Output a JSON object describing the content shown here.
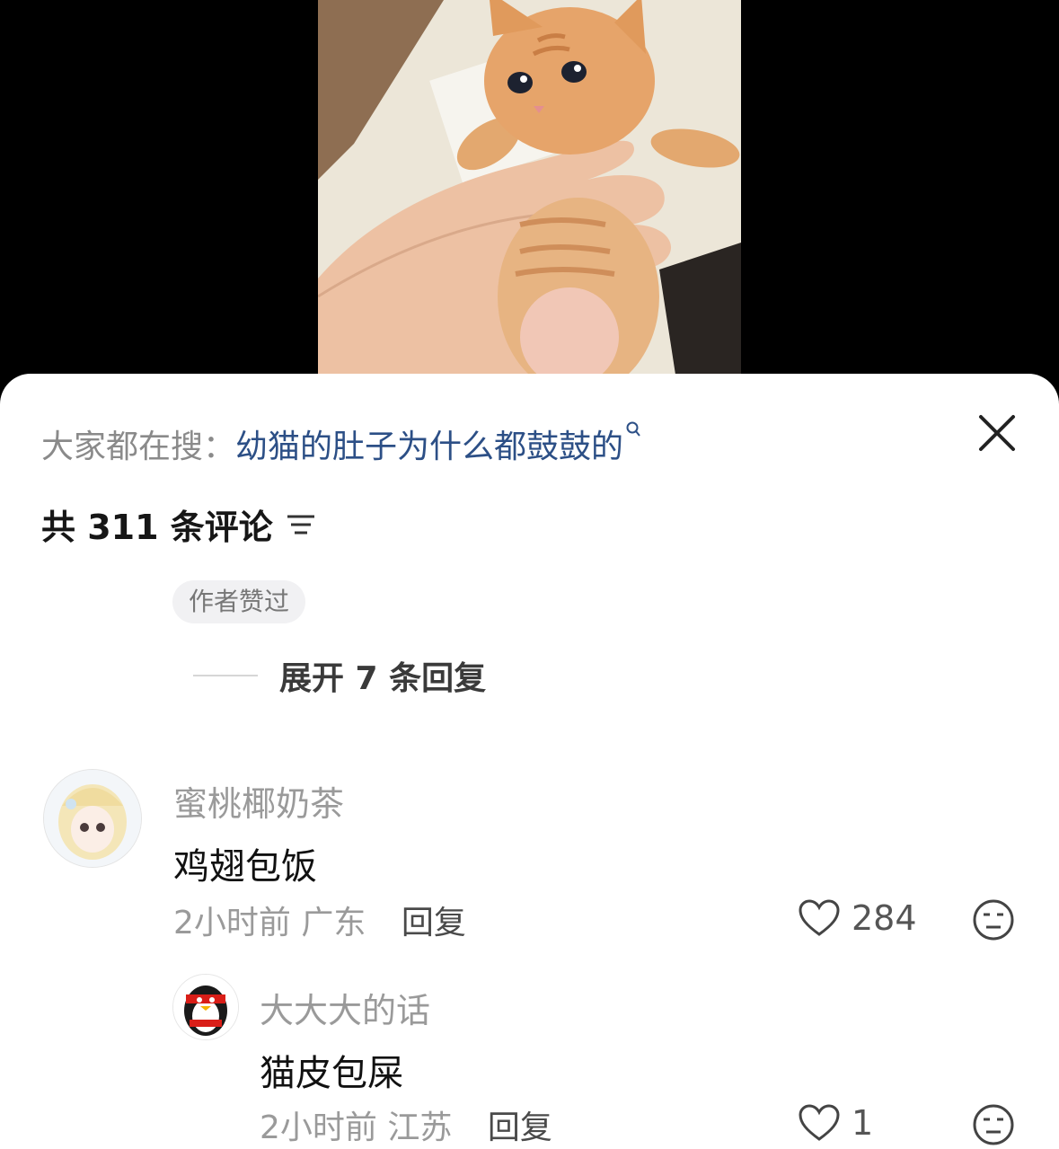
{
  "search_bar": {
    "label": "大家都在搜：",
    "query": "幼猫的肚子为什么都鼓鼓的"
  },
  "comments_header": {
    "count_label": "共 311 条评论"
  },
  "author_liked_badge": "作者赞过",
  "expand_replies": "展开 7 条回复",
  "comments": [
    {
      "username": "蜜桃椰奶茶",
      "text": "鸡翅包饭",
      "time": "2小时前",
      "location": "广东",
      "reply_label": "回复",
      "likes": "284"
    },
    {
      "username": "大大大的话",
      "text": "猫皮包屎",
      "time": "2小时前",
      "location": "江苏",
      "reply_label": "回复",
      "likes": "1"
    }
  ],
  "icons": {
    "close": "close-icon",
    "search": "search-icon",
    "sort": "sort-icon",
    "like": "heart-icon",
    "dislike": "dislike-face-icon"
  },
  "colors": {
    "query_link": "#2c4f86",
    "muted_text": "#9a9a9a",
    "sheet_bg": "#ffffff",
    "video_bg": "#000000"
  }
}
